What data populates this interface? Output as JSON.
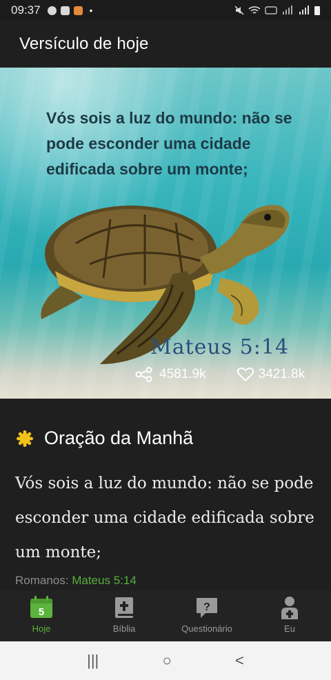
{
  "status_bar": {
    "time": "09:37",
    "dot": "•"
  },
  "header": {
    "title": "Versículo de hoje"
  },
  "hero": {
    "verse_text": "Vós sois a luz do mundo: não se pode esconder uma cidade edificada sobre um monte;",
    "reference": "Mateus 5:14",
    "shares": "4581.9k",
    "likes": "3421.8k"
  },
  "section": {
    "title": "Oração da Manhã",
    "body": "Vós sois a luz do mundo: não se pode esconder uma cidade edificada sobre um monte;",
    "source_label": "Romanos:",
    "source_link": "Mateus 5:14"
  },
  "bottom_nav": {
    "items": [
      {
        "label": "Hoje",
        "icon": "calendar-icon",
        "badge": "5"
      },
      {
        "label": "Bíblia",
        "icon": "bible-icon"
      },
      {
        "label": "Questionário",
        "icon": "quiz-icon",
        "glyph": "?"
      },
      {
        "label": "Eu",
        "icon": "profile-icon"
      }
    ]
  },
  "system_nav": {
    "recents": "|||",
    "home": "○",
    "back": "<"
  },
  "colors": {
    "accent": "#5cb33d",
    "sun": "#f2c21b",
    "reference": "#2c4e7c"
  }
}
